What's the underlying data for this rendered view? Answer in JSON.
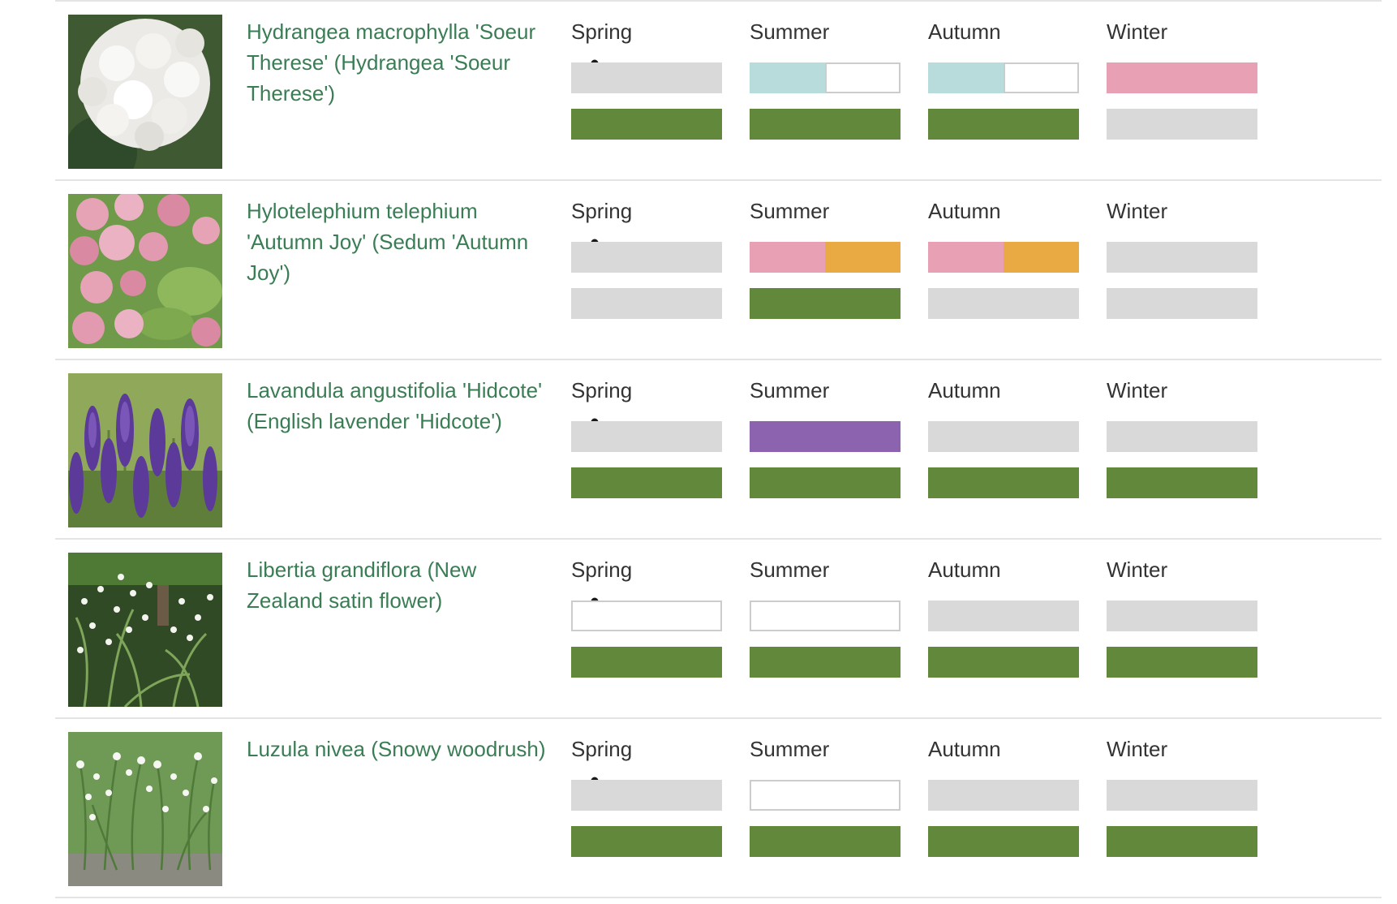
{
  "colors": {
    "none": "#d9d9d9",
    "green": "#62893b",
    "lightblue": "#b7dcdb",
    "pink": "#e8a1b4",
    "orange": "#e9aa44",
    "purple": "#8b63af",
    "white": "#ffffff",
    "link": "#3a7d55"
  },
  "icons": {
    "flower": "flower-icon",
    "foliage": "leaf-icon"
  },
  "seasons": [
    "Spring",
    "Summer",
    "Autumn",
    "Winter"
  ],
  "plants": [
    {
      "name": "Hydrangea macrophylla 'Soeur Therese' (Hydrangea 'Soeur Therese')",
      "image": "white-hydrangea-photo",
      "flower": [
        [
          "none"
        ],
        [
          "lightblue",
          "white"
        ],
        [
          "lightblue",
          "white"
        ],
        [
          "pink"
        ]
      ],
      "foliage": [
        [
          "green"
        ],
        [
          "green"
        ],
        [
          "green"
        ],
        [
          "none"
        ]
      ]
    },
    {
      "name": "Hylotelephium telephium 'Autumn Joy' (Sedum 'Autumn Joy')",
      "image": "pink-sedum-photo",
      "flower": [
        [
          "none"
        ],
        [
          "pink",
          "orange"
        ],
        [
          "pink",
          "orange"
        ],
        [
          "none"
        ]
      ],
      "foliage": [
        [
          "none"
        ],
        [
          "green"
        ],
        [
          "none"
        ],
        [
          "none"
        ]
      ]
    },
    {
      "name": "Lavandula angustifolia 'Hidcote' (English lavender 'Hidcote')",
      "image": "lavender-photo",
      "flower": [
        [
          "none"
        ],
        [
          "purple"
        ],
        [
          "none"
        ],
        [
          "none"
        ]
      ],
      "foliage": [
        [
          "green"
        ],
        [
          "green"
        ],
        [
          "green"
        ],
        [
          "green"
        ]
      ]
    },
    {
      "name": "Libertia grandiflora (New Zealand satin flower)",
      "image": "libertia-photo",
      "flower": [
        [
          "white"
        ],
        [
          "white"
        ],
        [
          "none"
        ],
        [
          "none"
        ]
      ],
      "foliage": [
        [
          "green"
        ],
        [
          "green"
        ],
        [
          "green"
        ],
        [
          "green"
        ]
      ]
    },
    {
      "name": "Luzula nivea (Snowy woodrush)",
      "image": "luzula-photo",
      "flower": [
        [
          "none"
        ],
        [
          "white"
        ],
        [
          "none"
        ],
        [
          "none"
        ]
      ],
      "foliage": [
        [
          "green"
        ],
        [
          "green"
        ],
        [
          "green"
        ],
        [
          "green"
        ]
      ]
    }
  ]
}
